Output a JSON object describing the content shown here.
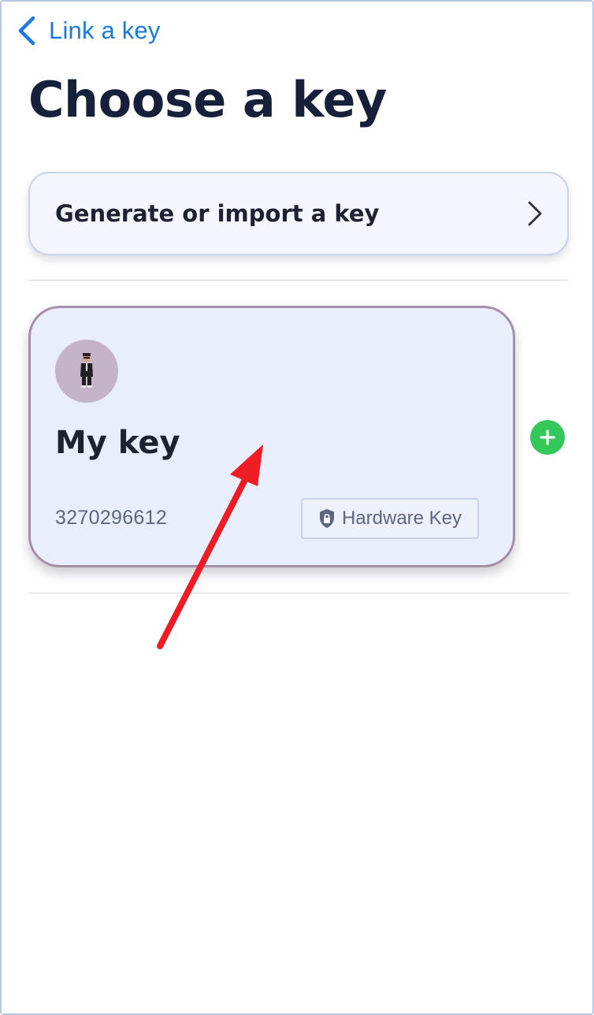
{
  "nav": {
    "back_label": "Link a key",
    "back_icon": "chevron-left-icon"
  },
  "page": {
    "title": "Choose a key"
  },
  "generate_row": {
    "label": "Generate or import a key",
    "icon": "chevron-right-icon"
  },
  "keys": [
    {
      "name": "My key",
      "id": "3270296612",
      "badge": {
        "label": "Hardware Key",
        "icon": "shield-lock-icon"
      },
      "avatar_icon": "person-avatar-icon"
    }
  ],
  "add_button": {
    "icon": "plus-icon"
  },
  "colors": {
    "accent": "#1a7ae0",
    "title": "#16203a",
    "card_bg": "#e8eefb",
    "card_border": "#a58ea8",
    "add_green": "#34c759",
    "annotation_red": "#ee1c25"
  }
}
